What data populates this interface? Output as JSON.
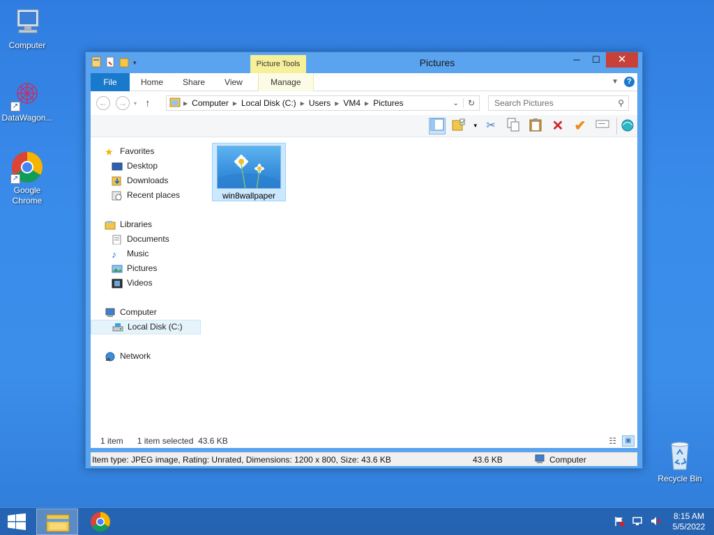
{
  "desktop": {
    "icons": [
      {
        "label": "Computer"
      },
      {
        "label": "DataWagon..."
      },
      {
        "label": "Google\nChrome"
      },
      {
        "label": "Recycle Bin"
      }
    ]
  },
  "window": {
    "title": "Pictures",
    "context_tab": "Picture Tools",
    "tabs": [
      "File",
      "Home",
      "Share",
      "View",
      "Manage"
    ],
    "buttons": {
      "minimize": "─",
      "maximize": "☐",
      "close": "✕"
    },
    "address": {
      "crumbs": [
        "Computer",
        "Local Disk (C:)",
        "Users",
        "VM4",
        "Pictures"
      ]
    },
    "search": {
      "placeholder": "Search Pictures"
    },
    "nav": {
      "favorites": {
        "label": "Favorites",
        "items": [
          "Desktop",
          "Downloads",
          "Recent places"
        ]
      },
      "libraries": {
        "label": "Libraries",
        "items": [
          "Documents",
          "Music",
          "Pictures",
          "Videos"
        ]
      },
      "computer": {
        "label": "Computer",
        "items": [
          "Local Disk (C:)"
        ]
      },
      "network": {
        "label": "Network"
      }
    },
    "files": [
      {
        "name": "win8wallpaper",
        "selected": true
      }
    ],
    "status": {
      "count": "1 item",
      "selection": "1 item selected  43.6 KB"
    },
    "details": {
      "info": "Item type: JPEG image, Rating: Unrated, Dimensions: 1200 x 800, Size: 43.6 KB",
      "size": "43.6 KB",
      "location": "Computer"
    }
  },
  "taskbar": {
    "time": "8:15 AM",
    "date": "5/5/2022"
  },
  "colors": {
    "desktop": "#3a8ceb",
    "file_tab": "#1979ca",
    "context_tab": "#f7f09a",
    "close_button": "#c7403a",
    "selection": "#cce8ff"
  }
}
